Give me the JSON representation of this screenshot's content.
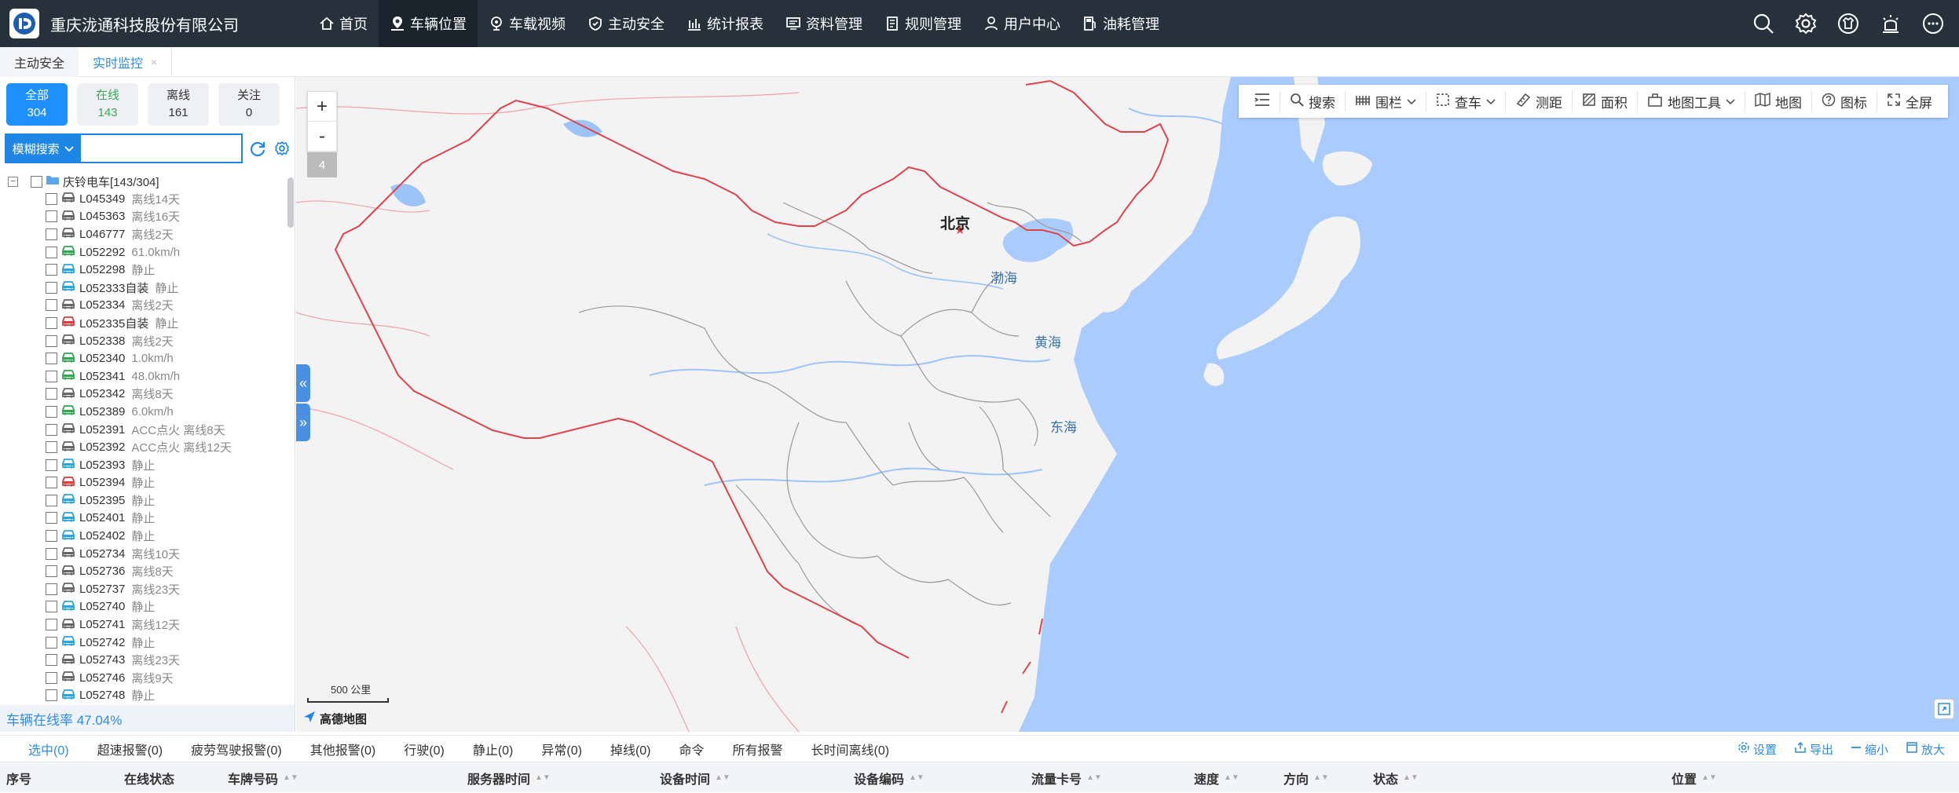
{
  "header": {
    "company": "重庆泷通科技股份有限公司",
    "nav": [
      {
        "label": "首页",
        "icon": "home-icon"
      },
      {
        "label": "车辆位置",
        "icon": "vehicle-location-icon",
        "active": true
      },
      {
        "label": "车载视频",
        "icon": "video-icon"
      },
      {
        "label": "主动安全",
        "icon": "shield-icon"
      },
      {
        "label": "统计报表",
        "icon": "bar-chart-icon"
      },
      {
        "label": "资料管理",
        "icon": "monitor-icon"
      },
      {
        "label": "规则管理",
        "icon": "document-icon"
      },
      {
        "label": "用户中心",
        "icon": "user-icon"
      },
      {
        "label": "油耗管理",
        "icon": "fuel-icon"
      }
    ],
    "right_icons": [
      "search-icon",
      "gear-icon",
      "shirt-icon",
      "alarm-light-icon",
      "more-icon"
    ]
  },
  "page_tabs": [
    {
      "label": "主动安全"
    },
    {
      "label": "实时监控",
      "close": "×"
    }
  ],
  "sidebar": {
    "status": [
      {
        "label": "全部",
        "count": "304"
      },
      {
        "label": "在线",
        "count": "143"
      },
      {
        "label": "离线",
        "count": "161"
      },
      {
        "label": "关注",
        "count": "0"
      }
    ],
    "search_mode": "模糊搜索",
    "search_value": "",
    "tree_root": "庆铃电车[143/304]",
    "vehicles": [
      {
        "plate": "L045349",
        "status": "离线14天",
        "color": "#666666"
      },
      {
        "plate": "L045363",
        "status": "离线16天",
        "color": "#666666"
      },
      {
        "plate": "L046777",
        "status": "离线2天",
        "color": "#666666"
      },
      {
        "plate": "L052292",
        "status": "61.0km/h",
        "color": "#2fa84f"
      },
      {
        "plate": "L052298",
        "status": "静止",
        "color": "#29a6df"
      },
      {
        "plate": "L052333自装",
        "status": "静止",
        "color": "#29a6df"
      },
      {
        "plate": "L052334",
        "status": "离线2天",
        "color": "#666666"
      },
      {
        "plate": "L052335自装",
        "status": "静止",
        "color": "#e03a3a"
      },
      {
        "plate": "L052338",
        "status": "离线2天",
        "color": "#666666"
      },
      {
        "plate": "L052340",
        "status": "1.0km/h",
        "color": "#2fa84f"
      },
      {
        "plate": "L052341",
        "status": "48.0km/h",
        "color": "#2fa84f"
      },
      {
        "plate": "L052342",
        "status": "离线8天",
        "color": "#666666"
      },
      {
        "plate": "L052389",
        "status": "6.0km/h",
        "color": "#2fa84f"
      },
      {
        "plate": "L052391",
        "status": "ACC点火 离线8天",
        "color": "#666666"
      },
      {
        "plate": "L052392",
        "status": "ACC点火 离线12天",
        "color": "#666666"
      },
      {
        "plate": "L052393",
        "status": "静止",
        "color": "#29a6df"
      },
      {
        "plate": "L052394",
        "status": "静止",
        "color": "#e03a3a"
      },
      {
        "plate": "L052395",
        "status": "静止",
        "color": "#29a6df"
      },
      {
        "plate": "L052401",
        "status": "静止",
        "color": "#29a6df"
      },
      {
        "plate": "L052402",
        "status": "静止",
        "color": "#29a6df"
      },
      {
        "plate": "L052734",
        "status": "离线10天",
        "color": "#666666"
      },
      {
        "plate": "L052736",
        "status": "离线8天",
        "color": "#666666"
      },
      {
        "plate": "L052737",
        "status": "离线23天",
        "color": "#666666"
      },
      {
        "plate": "L052740",
        "status": "静止",
        "color": "#29a6df"
      },
      {
        "plate": "L052741",
        "status": "离线12天",
        "color": "#666666"
      },
      {
        "plate": "L052742",
        "status": "静止",
        "color": "#29a6df"
      },
      {
        "plate": "L052743",
        "status": "离线23天",
        "color": "#666666"
      },
      {
        "plate": "L052746",
        "status": "离线9天",
        "color": "#666666"
      },
      {
        "plate": "L052748",
        "status": "静止",
        "color": "#29a6df"
      }
    ],
    "online_rate": "车辆在线率 47.04%"
  },
  "map": {
    "zoom_in": "+",
    "zoom_out": "-",
    "zoom_level": "4",
    "collapse_left": "«",
    "collapse_right": "»",
    "tools": [
      {
        "label": "",
        "icon": "list-icon"
      },
      {
        "label": "搜索",
        "icon": "search-icon"
      },
      {
        "label": "围栏",
        "icon": "fence-icon",
        "dropdown": true
      },
      {
        "label": "查车",
        "icon": "select-box-icon",
        "dropdown": true
      },
      {
        "label": "测距",
        "icon": "ruler-icon"
      },
      {
        "label": "面积",
        "icon": "area-icon"
      },
      {
        "label": "地图工具",
        "icon": "map-tools-icon",
        "dropdown": true
      },
      {
        "label": "地图",
        "icon": "map-icon"
      },
      {
        "label": "图标",
        "icon": "help-icon"
      },
      {
        "label": "全屏",
        "icon": "fullscreen-icon"
      }
    ],
    "labels": {
      "beijing": "北京",
      "bohai": "渤海",
      "huanghai": "黄海",
      "donghai": "东海"
    },
    "scale": "500 公里",
    "provider": "高德地图",
    "colors": {
      "land": "#f3f3f3",
      "sea": "#aacbfd",
      "border": "#e0434b",
      "rivers": "#9cc4f6"
    }
  },
  "alarms": {
    "tabs": [
      "选中(0)",
      "超速报警(0)",
      "疲劳驾驶报警(0)",
      "其他报警(0)",
      "行驶(0)",
      "静止(0)",
      "异常(0)",
      "掉线(0)",
      "命令",
      "所有报警",
      "长时间离线(0)"
    ],
    "tools": [
      {
        "label": "设置",
        "icon": "gear-icon"
      },
      {
        "label": "导出",
        "icon": "export-icon"
      },
      {
        "label": "缩小",
        "icon": "minimize-icon"
      },
      {
        "label": "放大",
        "icon": "maximize-icon"
      }
    ]
  },
  "table": {
    "columns": [
      {
        "label": "序号",
        "sortable": false
      },
      {
        "label": "在线状态",
        "sortable": false
      },
      {
        "label": "车牌号码",
        "sortable": true
      },
      {
        "label": "服务器时间",
        "sortable": true
      },
      {
        "label": "设备时间",
        "sortable": true
      },
      {
        "label": "设备编码",
        "sortable": true
      },
      {
        "label": "流量卡号",
        "sortable": true
      },
      {
        "label": "速度",
        "sortable": true
      },
      {
        "label": "方向",
        "sortable": true
      },
      {
        "label": "状态",
        "sortable": true
      },
      {
        "label": "位置",
        "sortable": true
      }
    ]
  }
}
